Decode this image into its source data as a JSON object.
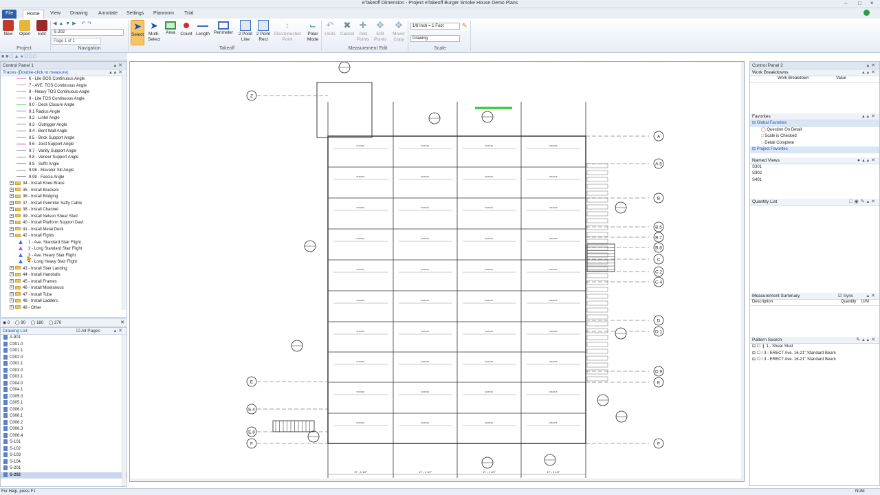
{
  "window": {
    "title": "eTakeoff Dimension - Project eTakeoff Burger Smoke House Demo Plans"
  },
  "tabs": [
    "File",
    "Home",
    "View",
    "Drawing",
    "Annotate",
    "Settings",
    "Planroom",
    "Trial"
  ],
  "ribbon": {
    "project": {
      "new": "New",
      "open": "Open",
      "edit": "Edit",
      "group": "Project"
    },
    "navigation": {
      "sheet": "S-202",
      "page": "Page 1 of 1",
      "group": "Navigation"
    },
    "takeoff": {
      "select": "Select",
      "multi": "Multi-\nSelect",
      "area": "Area",
      "count": "Count",
      "length": "Length",
      "perimeter": "Perimeter",
      "line2": "2 Point\nLine",
      "rect2": "2 Point\nRect",
      "disc": "Disconnected\nPoint",
      "polar": "Polar\nMode",
      "group": "Takeoff"
    },
    "edit": {
      "undo": "Undo",
      "cancel": "Cancel",
      "add": "Add\nPoints",
      "editp": "Edit\nPoints",
      "move": "Move/\nCopy",
      "group": "Measurement Edit"
    },
    "scale": {
      "value": "1/8 Inch = 1 Foot",
      "type": "Drawing",
      "group": "Scale"
    }
  },
  "cp1": {
    "title": "Control Panel 1",
    "traces_title": "Traces (Double-click to measure)",
    "angles": [
      {
        "label": "6 - Lite BOS Continuous Angle",
        "color": "#c987c9"
      },
      {
        "label": "7 - AVE. TOS Continuous Angle",
        "color": "#c987c9"
      },
      {
        "label": "8 - Heavy TOS Continuous Angle",
        "color": "#c987c9"
      },
      {
        "label": "9 - Lite TOS Continuous Angle",
        "color": "#c987c9"
      },
      {
        "label": "9.0 - Deck Closure Angle",
        "color": "#47c847"
      },
      {
        "label": "9.1 Radius Angle",
        "color": "#8a8ab8"
      },
      {
        "label": "9.2 - Lintel Angle",
        "color": "#8a8ab8"
      },
      {
        "label": "9.3 - Outrigger Angle",
        "color": "#8a8ab8"
      },
      {
        "label": "9.4 - Bent Wall Angle",
        "color": "#8a8ab8"
      },
      {
        "label": "9.5 - Brick Support Angle",
        "color": "#8a8ab8"
      },
      {
        "label": "9.6 - Joist Support Angle",
        "color": "#c040c0"
      },
      {
        "label": "9.7 - Vanity Support Angle",
        "color": "#8a8ab8"
      },
      {
        "label": "9.8 - Veneer Support Angle",
        "color": "#8a8ab8"
      },
      {
        "label": "9.9 - Soffit Angle",
        "color": "#8a8ab8"
      },
      {
        "label": "9.98 - Elevator Sill Angle",
        "color": "#8a8ab8"
      },
      {
        "label": "9.99 - Fascia Angle",
        "color": "#8a8ab8"
      }
    ],
    "groups_a": [
      "34 - Install Knee Brace",
      "35 - Install Brackets",
      "36 - Install Bridging",
      "37 - Install Perimiter Safty Cable",
      "38 - Install Channel",
      "39 - Install Nelson Shear Stud",
      "40 - Install Platform Support Davt",
      "41 - Install Metal Deck",
      "42 - Install Fights"
    ],
    "flights": [
      {
        "label": "1 - Ave. Standard Stair Flight",
        "color": "#4b6fd8"
      },
      {
        "label": "2 - Long Standard Stair Flight",
        "color": "#d04bd0"
      },
      {
        "label": "3 - Ave. Heavy Stair Flight",
        "color": "#4b6fd8"
      },
      {
        "label": "4 - Long Heavy Stair Flight",
        "color": "#4b6fd8"
      }
    ],
    "groups_b": [
      "43 - Install Stair Landing",
      "44 - Install Handrails",
      "45 - Install Frames",
      "46 - Install Miselanous",
      "47 - Install Tube",
      "48 - Install Ladders",
      "49 - Other"
    ],
    "rotation": [
      "0",
      "90",
      "180",
      "270"
    ],
    "drawing_list_title": "Drawing List",
    "all_pages": "All Pages",
    "drawings": [
      "A-901",
      "C001.0",
      "C001.1",
      "C002.0",
      "C002.1",
      "C003.0",
      "C003.1",
      "C004.0",
      "C004.1",
      "C005.0",
      "C005.1",
      "C006.0",
      "C006.1",
      "C006.2",
      "C006.3",
      "C006.4",
      "S-101",
      "S-102",
      "S-103",
      "S-104",
      "S-201",
      "S-202"
    ]
  },
  "cp2": {
    "title": "Control Panel 2",
    "wb_title": "Work Breakdowns",
    "wb_cols": [
      "Work Breakdown",
      "Value"
    ],
    "fav_title": "Favorites",
    "global_fav": "Global Favorites",
    "fav_items": [
      "Question On Detail",
      "Scale is Checked",
      "Detail Complete"
    ],
    "project_fav": "Project Favorites",
    "views_title": "Named Views",
    "views": [
      "S301",
      "S302",
      "S401"
    ],
    "qty_title": "Quantity List",
    "ms_title": "Measurement Summary",
    "sync": "Sync",
    "ms_cols": [
      "Description",
      "Quantity",
      "U/M"
    ],
    "ps_title": "Pattern Search",
    "patterns": [
      "1 - Shear Stud",
      "3 - ERECT Ave. 16-21\" Standard Beam",
      "3 - ERECT Ave. 16-21\" Standard Beam"
    ]
  },
  "plan": {
    "grid_right": [
      "A",
      "A.5",
      "B",
      "B.5",
      "B.7",
      "B.8",
      "C",
      "C.2",
      "C.4",
      "D",
      "D.1",
      "D.9",
      "E",
      "F"
    ],
    "grid_left": [
      "Z",
      "E",
      "E.4",
      "E.8",
      "F"
    ],
    "dims": [
      "17' - 1 1/2\"",
      "17' - 1 1/2\"",
      "17' - 1 1/2\"",
      "17' - 1 1/2\"",
      "17' - 1 1/2\""
    ],
    "highlight": "#22cc22"
  },
  "status": {
    "left": "For Help, press F1",
    "right": "NUM"
  }
}
